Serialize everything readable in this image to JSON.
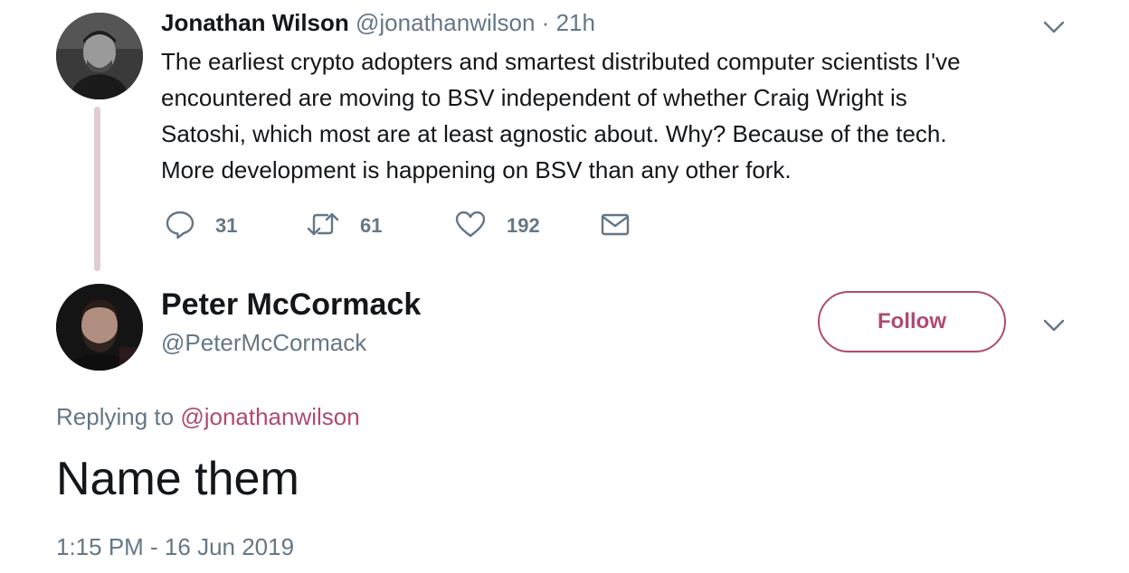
{
  "parent_tweet": {
    "author_name": "Jonathan Wilson",
    "handle": "@jonathanwilson",
    "separator": "·",
    "time": "21h",
    "text_lines": [
      "The earliest crypto adopters and smartest distributed computer scientists I've",
      "encountered are moving to BSV independent of whether Craig Wright is",
      "Satoshi, which most are at least agnostic about. Why? Because of the tech.",
      "More development is happening on BSV than any other fork."
    ],
    "actions": {
      "reply_count": "31",
      "retweet_count": "61",
      "like_count": "192"
    },
    "icons": {
      "reply": "speech-bubble-icon",
      "retweet": "retweet-arrows-icon",
      "like": "heart-icon",
      "dm": "envelope-icon",
      "menu": "chevron-down-icon"
    }
  },
  "main_tweet": {
    "author_name": "Peter McCormack",
    "handle": "@PeterMcCormack",
    "follow_label": "Follow",
    "replying_prefix": "Replying to",
    "replying_handle": "@jonathanwilson",
    "text": "Name them",
    "timestamp": "1:15 PM - 16 Jun 2019"
  },
  "colors": {
    "accent": "#b04a72",
    "text_primary": "#14171a",
    "text_secondary": "#657786",
    "thread_line": "#e1ccd4"
  }
}
